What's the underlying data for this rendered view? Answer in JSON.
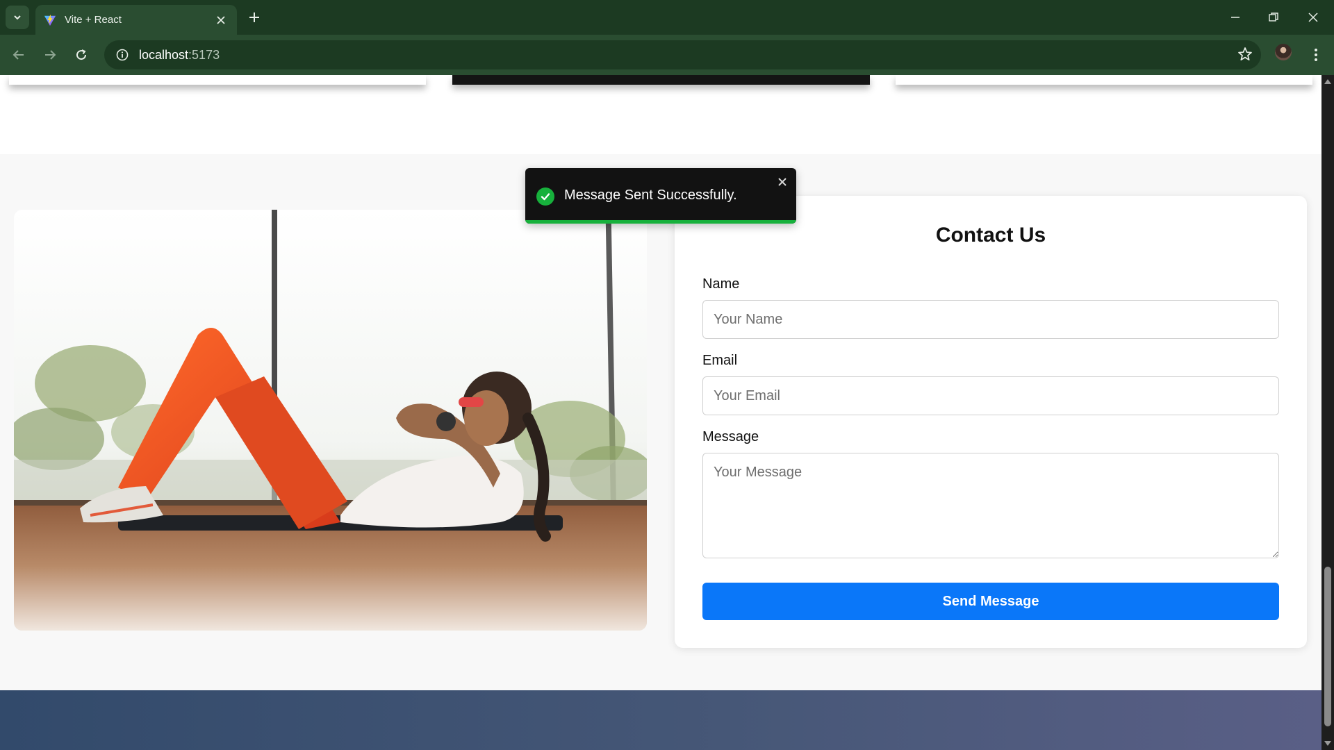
{
  "browser": {
    "tab_title": "Vite + React",
    "url_host": "localhost",
    "url_port": ":5173"
  },
  "toast": {
    "message": "Message Sent Successfully.",
    "status": "success",
    "progress_fraction": 1.0,
    "color": "#17b13c"
  },
  "hero_image": {
    "description_icon": "woman-doing-crunches-photo"
  },
  "contact": {
    "title": "Contact Us",
    "name_label": "Name",
    "name_placeholder": "Your Name",
    "email_label": "Email",
    "email_placeholder": "Your Email",
    "message_label": "Message",
    "message_placeholder": "Your Message",
    "submit_label": "Send Message",
    "accent_color": "#0a77f9"
  }
}
